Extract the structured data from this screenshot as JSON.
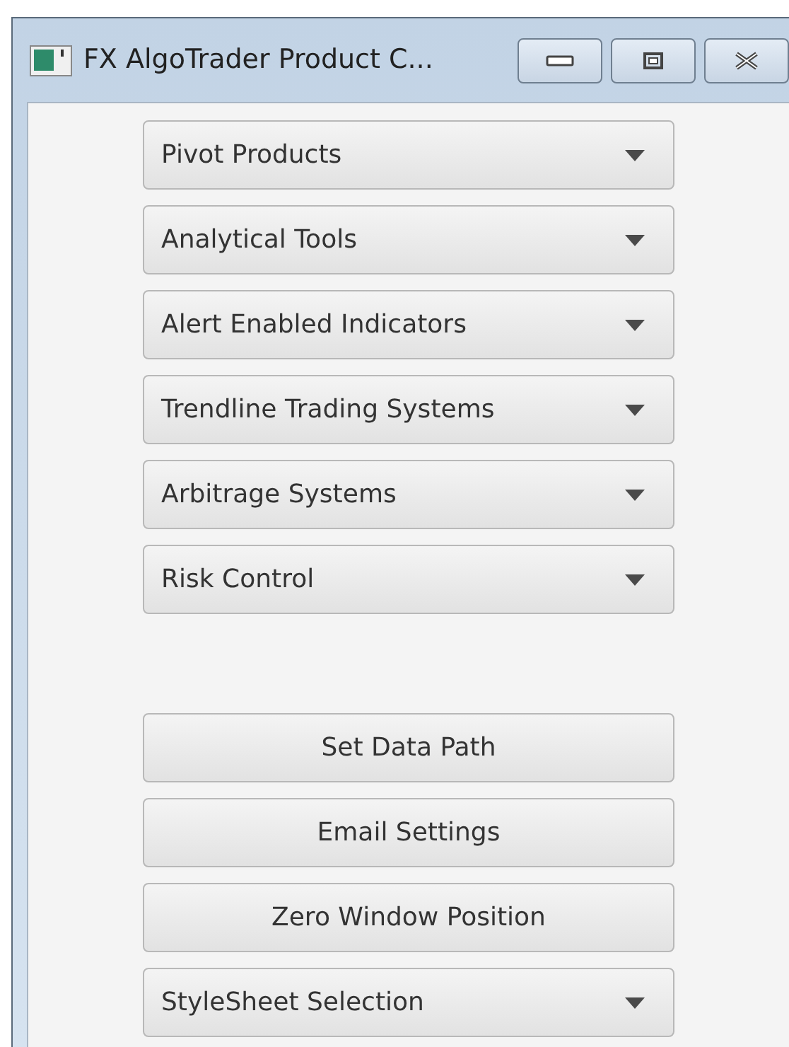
{
  "window": {
    "title": "FX AlgoTrader Product C..."
  },
  "menus": [
    {
      "label": "Pivot Products"
    },
    {
      "label": "Analytical Tools"
    },
    {
      "label": "Alert Enabled Indicators"
    },
    {
      "label": "Trendline Trading Systems"
    },
    {
      "label": "Arbitrage Systems"
    },
    {
      "label": "Risk Control"
    }
  ],
  "actions": [
    {
      "kind": "button",
      "label": "Set Data Path"
    },
    {
      "kind": "button",
      "label": "Email Settings"
    },
    {
      "kind": "button",
      "label": "Zero Window Position"
    },
    {
      "kind": "dropdown",
      "label": "StyleSheet Selection"
    }
  ]
}
